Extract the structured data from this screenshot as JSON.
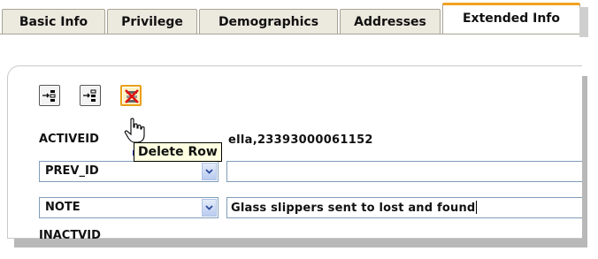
{
  "tabs": [
    {
      "label": "Basic Info",
      "active": false
    },
    {
      "label": "Privilege",
      "active": false
    },
    {
      "label": "Demographics",
      "active": false
    },
    {
      "label": "Addresses",
      "active": false
    },
    {
      "label": "Extended Info",
      "active": true
    }
  ],
  "toolbar": {
    "buttons": [
      {
        "name": "insert-row-above-icon"
      },
      {
        "name": "insert-row-below-icon"
      },
      {
        "name": "delete-row-icon"
      }
    ],
    "tooltip": "Delete Row"
  },
  "rows": {
    "activeid": {
      "label": "ACTIVEID",
      "value": "ella,23393000061152"
    },
    "prev_id": {
      "selected": "PREV_ID",
      "value": ""
    },
    "note": {
      "selected": "NOTE",
      "value": "Glass slippers sent to lost and found"
    },
    "inactvid": {
      "label": "INACTVID"
    }
  },
  "colors": {
    "active_tab_accent": "#f4a11f",
    "tooltip_bg": "#ffffe1",
    "combo_border": "#7f9db9"
  }
}
